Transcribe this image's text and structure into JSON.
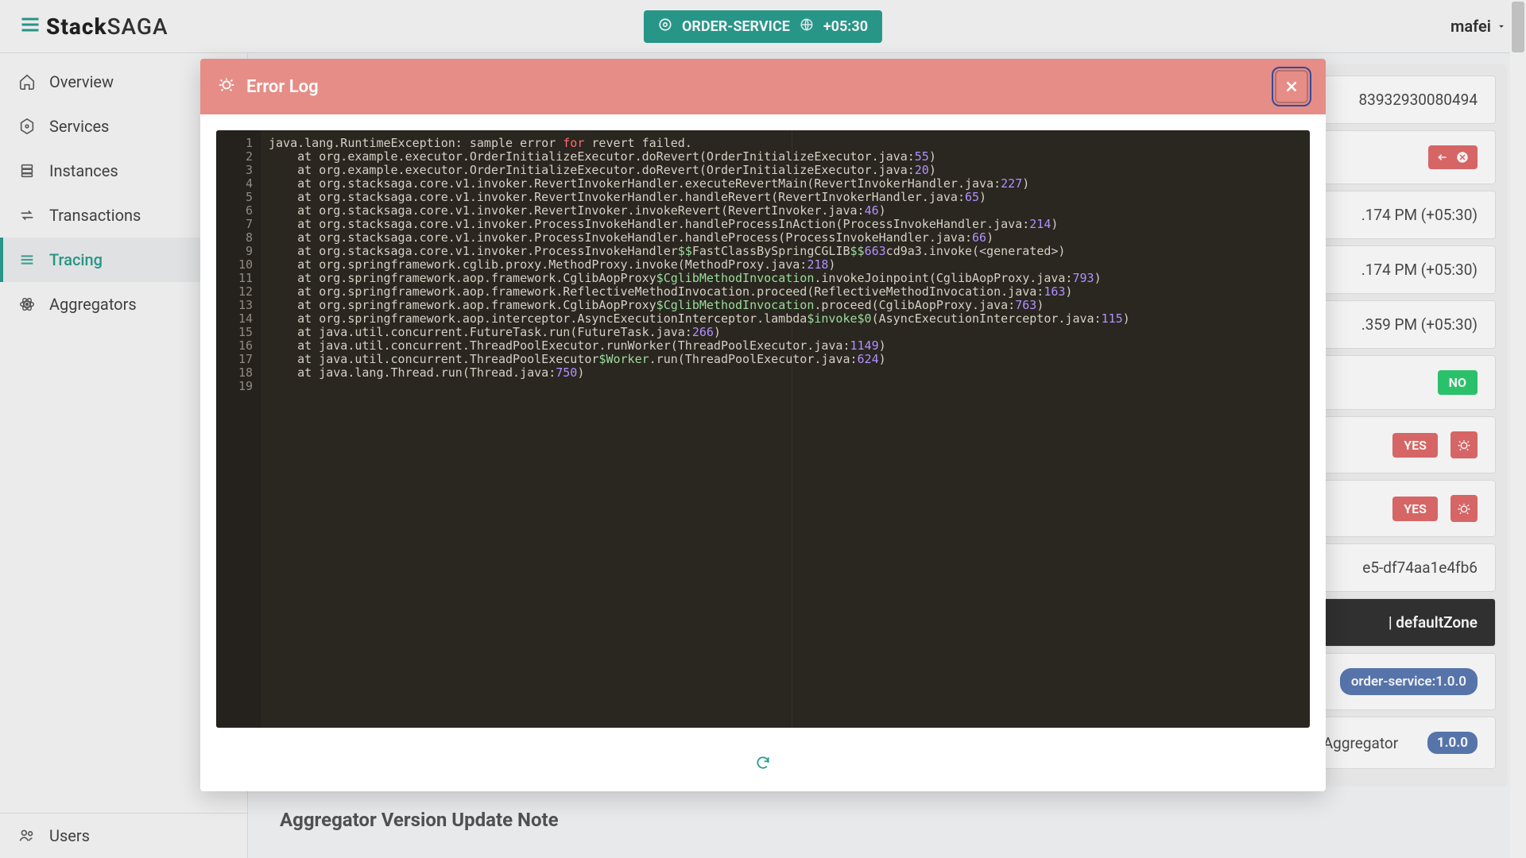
{
  "header": {
    "logo_bold": "Stack",
    "logo_light": "SAGA",
    "service_name": "ORDER-SERVICE",
    "tz": "+05:30",
    "user": "mafei"
  },
  "sidebar": {
    "items": [
      {
        "label": "Overview",
        "icon": "home-icon"
      },
      {
        "label": "Services",
        "icon": "hex-icon"
      },
      {
        "label": "Instances",
        "icon": "stack-icon"
      },
      {
        "label": "Transactions",
        "icon": "swap-icon"
      },
      {
        "label": "Tracing",
        "icon": "lines-icon"
      },
      {
        "label": "Aggregators",
        "icon": "atom-icon"
      }
    ],
    "bottom": {
      "label": "Users",
      "icon": "users-icon"
    }
  },
  "bg": {
    "id_tail": "83932930080494",
    "ts": ".174 PM (+05:30)",
    "ts2": ".174 PM (+05:30)",
    "ts3": ".359 PM (+05:30)",
    "no": "NO",
    "yes": "YES",
    "uuid_tail": "e5-df74aa1e4fb6",
    "zone": " | defaultZone",
    "svc_pill": "order-service:1.0.0",
    "agg_text": "Aggregator",
    "agg_ver": "1.0.0",
    "section": "Aggregator Version Update Note"
  },
  "modal": {
    "title": "Error Log",
    "lines": [
      {
        "prefix": "java.lang.RuntimeException: sample error ",
        "kw": "for",
        "mid": " revert failed.",
        "num": "",
        "tail": ""
      },
      {
        "prefix": "    at org.example.executor.OrderInitializeExecutor.doRevert(OrderInitializeExecutor.java:",
        "num": "55",
        "tail": ")"
      },
      {
        "prefix": "    at org.example.executor.OrderInitializeExecutor.doRevert(OrderInitializeExecutor.java:",
        "num": "20",
        "tail": ")"
      },
      {
        "prefix": "    at org.stacksaga.core.v1.invoker.RevertInvokerHandler.executeRevertMain(RevertInvokerHandler.java:",
        "num": "227",
        "tail": ")"
      },
      {
        "prefix": "    at org.stacksaga.core.v1.invoker.RevertInvokerHandler.handleRevert(RevertInvokerHandler.java:",
        "num": "65",
        "tail": ")"
      },
      {
        "prefix": "    at org.stacksaga.core.v1.invoker.RevertInvoker.invokeRevert(RevertInvoker.java:",
        "num": "46",
        "tail": ")"
      },
      {
        "prefix": "    at org.stacksaga.core.v1.invoker.ProcessInvokeHandler.handleProcessInAction(ProcessInvokeHandler.java:",
        "num": "214",
        "tail": ")"
      },
      {
        "prefix": "    at org.stacksaga.core.v1.invoker.ProcessInvokeHandler.handleProcess(ProcessInvokeHandler.java:",
        "num": "66",
        "tail": ")"
      },
      {
        "prefix": "    at org.stacksaga.core.v1.invoker.ProcessInvokeHandler",
        "sym1": "$$",
        "mid": "FastClassBySpringCGLIB",
        "sym2": "$$",
        "num": "663",
        "mid2": "cd9a3.invoke(",
        "angle1": "<",
        "gen": "generated",
        "angle2": ">",
        "tail": ")"
      },
      {
        "prefix": "    at org.springframework.cglib.proxy.MethodProxy.invoke(MethodProxy.java:",
        "num": "218",
        "tail": ")"
      },
      {
        "prefix": "    at org.springframework.aop.framework.CglibAopProxy",
        "sym1": "$CglibMethodInvocation",
        "mid": ".invokeJoinpoint(CglibAopProxy.java:",
        "num": "793",
        "tail": ")"
      },
      {
        "prefix": "    at org.springframework.aop.framework.ReflectiveMethodInvocation.proceed(ReflectiveMethodInvocation.java:",
        "num": "163",
        "tail": ")"
      },
      {
        "prefix": "    at org.springframework.aop.framework.CglibAopProxy",
        "sym1": "$CglibMethodInvocation",
        "mid": ".proceed(CglibAopProxy.java:",
        "num": "763",
        "tail": ")"
      },
      {
        "prefix": "    at org.springframework.aop.interceptor.AsyncExecutionInterceptor.lambda",
        "sym1": "$invoke$0",
        "mid": "(AsyncExecutionInterceptor.java:",
        "num": "115",
        "tail": ")"
      },
      {
        "prefix": "    at java.util.concurrent.FutureTask.run(FutureTask.java:",
        "num": "266",
        "tail": ")"
      },
      {
        "prefix": "    at java.util.concurrent.ThreadPoolExecutor.runWorker(ThreadPoolExecutor.java:",
        "num": "1149",
        "tail": ")"
      },
      {
        "prefix": "    at java.util.concurrent.ThreadPoolExecutor",
        "sym1": "$Worker",
        "mid": ".run(ThreadPoolExecutor.java:",
        "num": "624",
        "tail": ")"
      },
      {
        "prefix": "    at java.lang.Thread.run(Thread.java:",
        "num": "750",
        "tail": ")"
      },
      {
        "prefix": "",
        "num": "",
        "tail": ""
      }
    ]
  }
}
